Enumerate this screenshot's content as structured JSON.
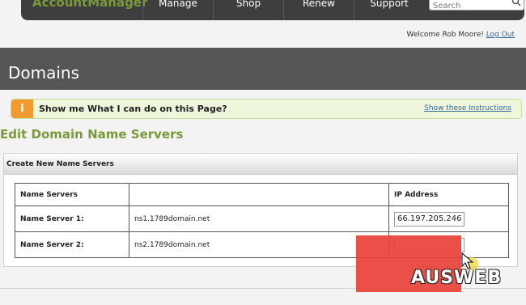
{
  "topnav": {
    "logo": "AccountManager",
    "items": [
      "Manage",
      "Shop",
      "Renew",
      "Support"
    ],
    "search_value": "Search"
  },
  "welcome": {
    "text": "Welcome Rob Moore!",
    "logout": "Log Out"
  },
  "page_title": "Domains",
  "help": {
    "icon": "i",
    "text": "Show me What I can do on this Page?",
    "link": "Show these Instructions"
  },
  "section_title": "Edit Domain Name Servers",
  "panel": {
    "header": "Create New Name Servers",
    "columns": [
      "Name Servers",
      "",
      "IP Address"
    ],
    "rows": [
      {
        "label": "Name Server 1:",
        "host": "ns1.1789domain.net",
        "ip": "66.197.205.246"
      },
      {
        "label": "Name Server 2:",
        "host": "ns2.1789domain.net",
        "ip": ""
      }
    ]
  },
  "watermark": "AUSWEB",
  "colors": {
    "brand_green": "#7a9a3a",
    "topbar": "#3e3e3e",
    "title_bar": "#555555",
    "info_orange": "#f39a2e",
    "link_blue": "#336699",
    "watermark_red": "#e8433a"
  }
}
